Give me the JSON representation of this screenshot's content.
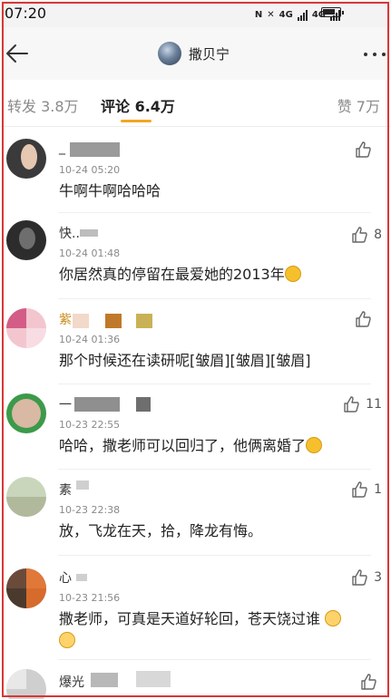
{
  "status_bar": {
    "time": "07:20",
    "net1": "4G",
    "net2": "4G"
  },
  "header": {
    "title": "撒贝宁",
    "icons": [
      "back-arrow-icon",
      "more-icon"
    ]
  },
  "tabs": [
    {
      "label": "转发 3.8万",
      "active": false
    },
    {
      "label": "评论 6.4万",
      "active": true
    },
    {
      "label": "赞 7万",
      "active": false
    }
  ],
  "comments": [
    {
      "name": "_",
      "time": "10-24 05:20",
      "text": "牛啊牛啊哈哈哈",
      "likes": ""
    },
    {
      "name": "快..",
      "time": "10-24 01:48",
      "text": "你居然真的停留在最爱她的2013年",
      "likes": "8"
    },
    {
      "name": "紫",
      "time": "10-24 01:36",
      "text": "那个时候还在读研呢[皱眉][皱眉][皱眉]",
      "likes": ""
    },
    {
      "name": "一",
      "time": "10-23 22:55",
      "text": "哈哈，撒老师可以回归了，他俩离婚了",
      "likes": "11"
    },
    {
      "name": "素",
      "time": "10-23 22:38",
      "text": "放，飞龙在天，拾，降龙有悔。",
      "likes": "1"
    },
    {
      "name": "心",
      "time": "10-23 21:56",
      "text": "撒老师，可真是天道好轮回，苍天饶过谁",
      "likes": "3"
    },
    {
      "name": "爆光",
      "time": "",
      "text": "",
      "likes": ""
    }
  ],
  "colors": {
    "accent": "#f5a623",
    "border": "#d93636"
  }
}
